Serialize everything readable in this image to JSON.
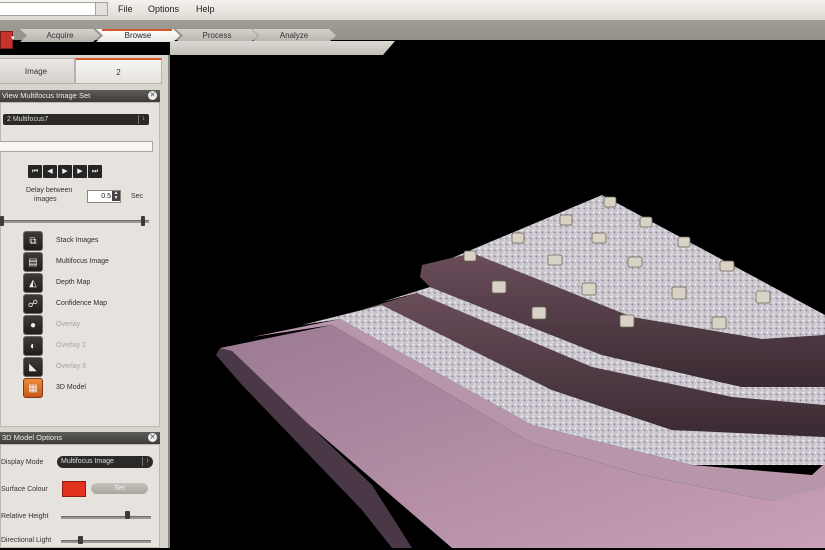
{
  "menubar": {
    "combo_value": "",
    "items": [
      "File",
      "Options",
      "Help"
    ]
  },
  "workflow_tabs": [
    "Acquire",
    "Browse",
    "Process",
    "Analyze"
  ],
  "workflow_active": "Browse",
  "panel": {
    "tabs": [
      "Image",
      "2"
    ],
    "multifocus": {
      "title": "View Multifocus Image Set",
      "set_select": "2 Multifocus7",
      "delay_label_line1": "Delay between",
      "delay_label_line2": "images",
      "delay_value": "0.5",
      "delay_unit": "Sec",
      "playback_position": 0.97,
      "view_modes": [
        {
          "icon": "stack-images-icon",
          "glyph": "⧉",
          "label": "Stack Images",
          "enabled": true
        },
        {
          "icon": "multifocus-image-icon",
          "glyph": "▤",
          "label": "Multifocus Image",
          "enabled": true
        },
        {
          "icon": "depth-map-icon",
          "glyph": "◭",
          "label": "Depth Map",
          "enabled": true
        },
        {
          "icon": "confidence-map-icon",
          "glyph": "☍",
          "label": "Confidence Map",
          "enabled": true
        },
        {
          "icon": "disabled-mode-1-icon",
          "glyph": "●",
          "label": "Overlay",
          "enabled": false
        },
        {
          "icon": "disabled-mode-2-icon",
          "glyph": "◐",
          "label": "Overlay 2",
          "enabled": false
        },
        {
          "icon": "disabled-mode-3-icon",
          "glyph": "◣",
          "label": "Overlay 3",
          "enabled": false
        },
        {
          "icon": "3d-model-icon",
          "glyph": "▦",
          "label": "3D Model",
          "enabled": true,
          "selected": true
        }
      ]
    },
    "model_options": {
      "title": "3D Model Options",
      "display_mode_label": "Display Mode",
      "display_mode_value": "Multifocus Image",
      "surface_colour_label": "Surface Colour",
      "surface_colour": "#e3331f",
      "surface_button": "Set",
      "relative_height_label": "Relative Height",
      "relative_height": 0.74,
      "directional_light_label": "Directional Light",
      "directional_light": 0.2
    }
  },
  "colors": {
    "accent": "#d3592a",
    "viewport_bg": "#000000"
  }
}
